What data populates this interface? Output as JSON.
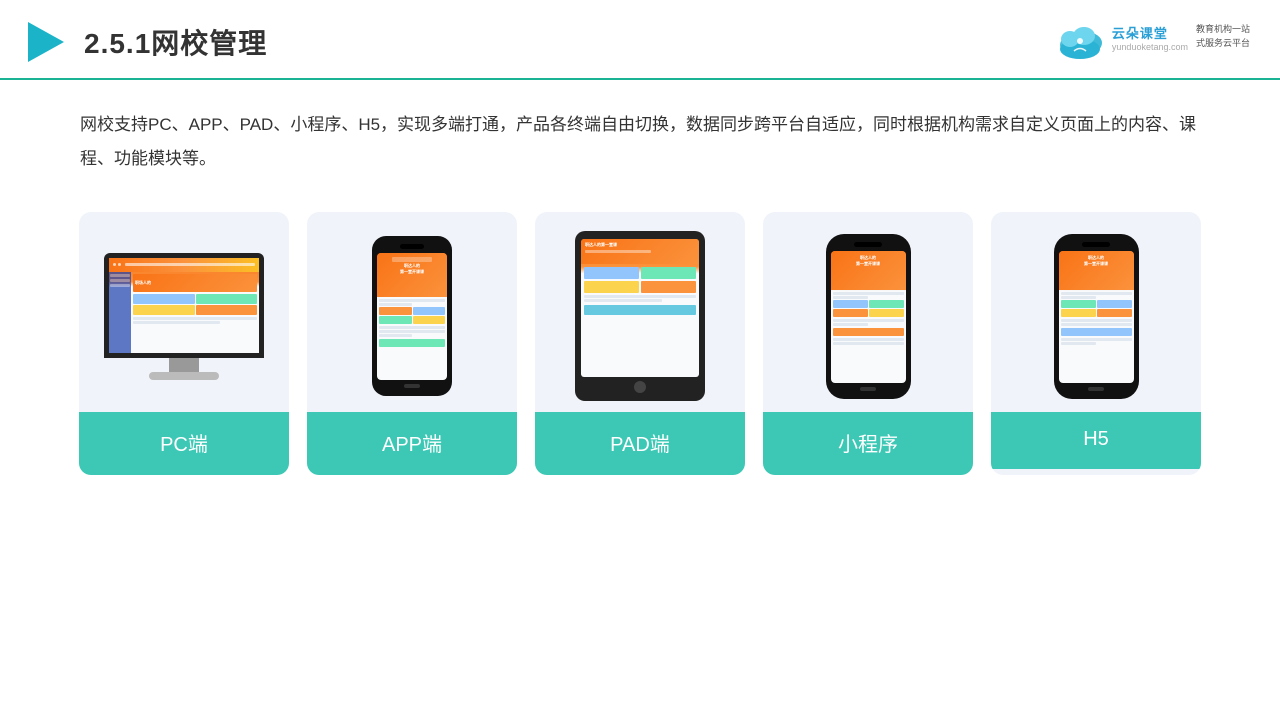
{
  "header": {
    "title": "2.5.1网校管理",
    "logo": {
      "brand": "云朵课堂",
      "url": "yunduoketang.com",
      "slogan": "教育机构一站\n式服务云平台"
    }
  },
  "description": "网校支持PC、APP、PAD、小程序、H5，实现多端打通，产品各终端自由切换，数据同步跨平台自适应，同时根据机构需求自定义页面上的内容、课程、功能模块等。",
  "cards": [
    {
      "id": "pc",
      "label": "PC端"
    },
    {
      "id": "app",
      "label": "APP端"
    },
    {
      "id": "pad",
      "label": "PAD端"
    },
    {
      "id": "mini",
      "label": "小程序"
    },
    {
      "id": "h5",
      "label": "H5"
    }
  ]
}
